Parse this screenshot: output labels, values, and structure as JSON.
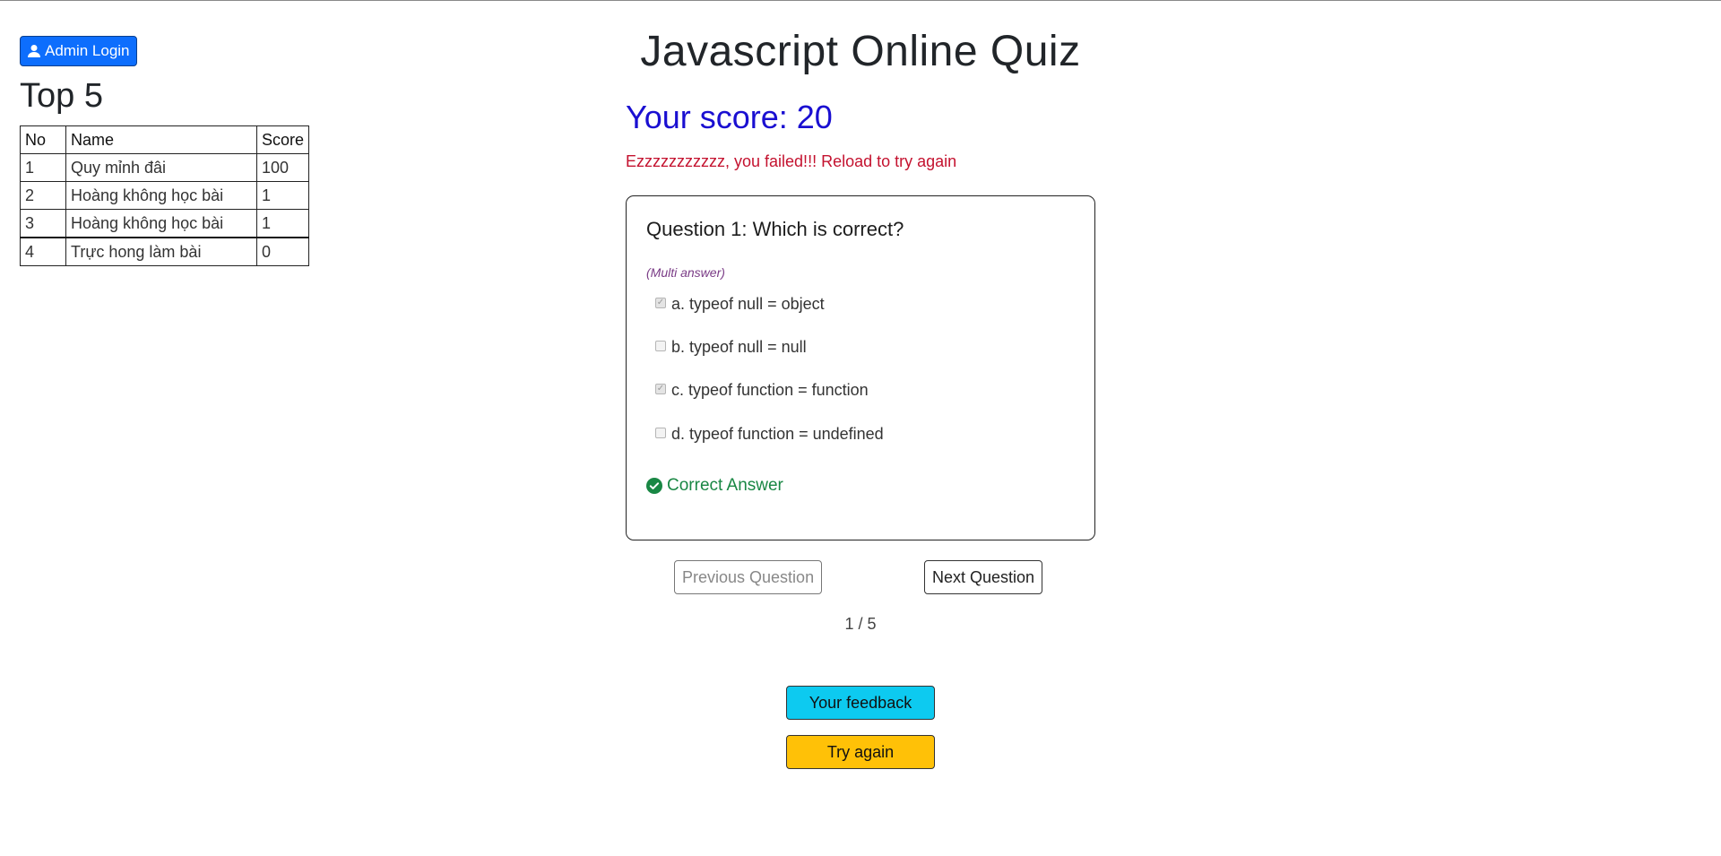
{
  "admin": {
    "label": "Admin Login"
  },
  "leaderboard": {
    "title": "Top 5",
    "headers": {
      "no": "No",
      "name": "Name",
      "score": "Score"
    },
    "rows": [
      {
        "no": "1",
        "name": "Quy mỉnh đâi",
        "score": "100"
      },
      {
        "no": "2",
        "name": "Hoàng không học bài",
        "score": "1"
      },
      {
        "no": "3",
        "name": "Hoàng không học bài",
        "score": "1"
      },
      {
        "no": "4",
        "name": "Trực hong làm bài",
        "score": "0"
      }
    ]
  },
  "quiz": {
    "title": "Javascript Online Quiz",
    "score_text": "Your score: 20",
    "fail_message": "Ezzzzzzzzzzz, you failed!!! Reload to try again",
    "question": {
      "text": "Question 1: Which is correct?",
      "mode": "(Multi answer)",
      "options": [
        {
          "label": "a. typeof null = object",
          "checked": true
        },
        {
          "label": "b. typeof null = null",
          "checked": false
        },
        {
          "label": "c. typeof function = function",
          "checked": true
        },
        {
          "label": "d. typeof function = undefined",
          "checked": false
        }
      ],
      "result": "Correct Answer"
    },
    "nav": {
      "prev_label": "Previous Question",
      "next_label": "Next Question",
      "pager": "1 / 5"
    },
    "actions": {
      "feedback_label": "Your feedback",
      "try_again_label": "Try again"
    }
  },
  "colors": {
    "primary": "#0d6efd",
    "score": "#1a0fd1",
    "danger": "#c4122f",
    "success": "#198744",
    "info": "#0dcaf0",
    "warning": "#ffc107"
  }
}
